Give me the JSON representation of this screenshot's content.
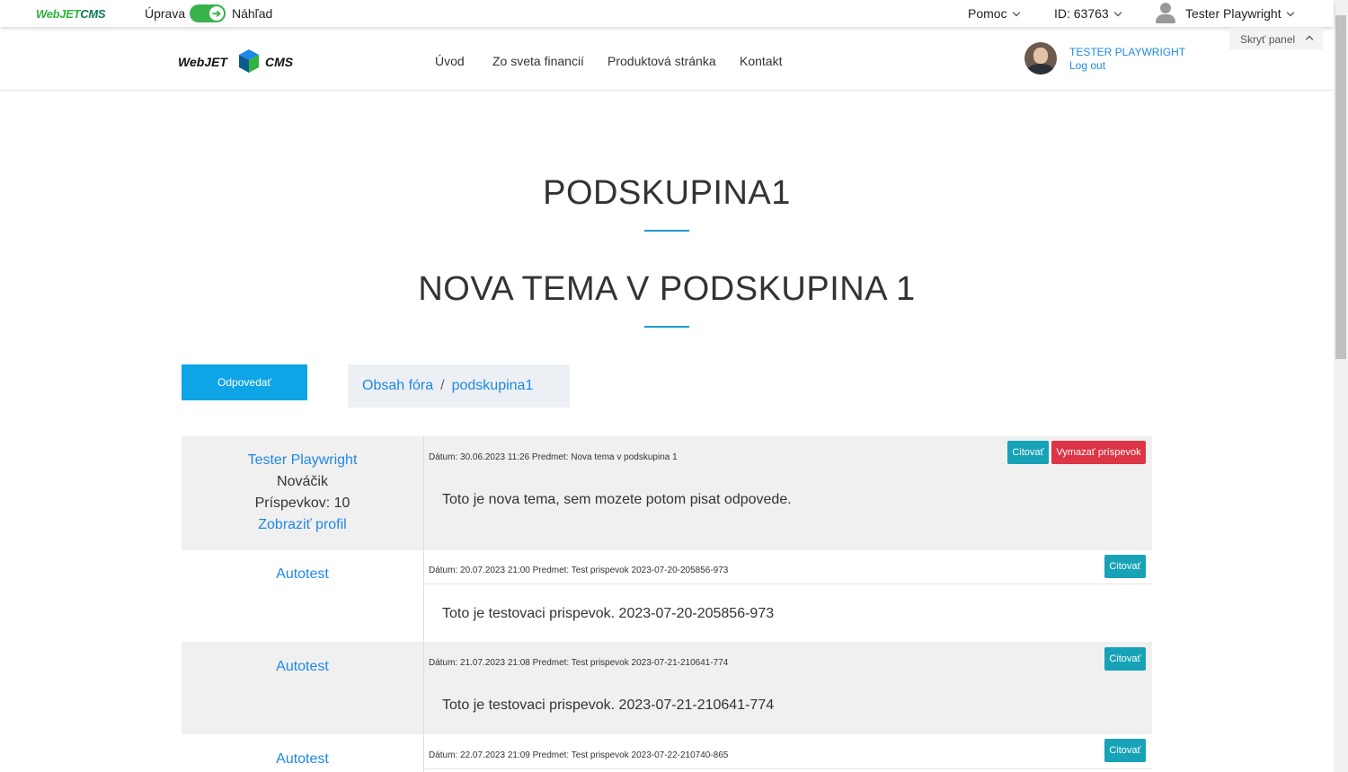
{
  "adminbar": {
    "logo_a": "WebJET",
    "logo_b": "CMS",
    "edit_label": "Úprava",
    "preview_label": "Náhľad",
    "help_label": "Pomoc",
    "doc_id": "ID: 63763",
    "user_name": "Tester Playwright",
    "hide_panel": "Skryť panel"
  },
  "site": {
    "logo_left": "WebJET",
    "logo_right": "CMS",
    "nav": [
      "Úvod",
      "Zo sveta financií",
      "Produktová stránka",
      "Kontakt"
    ],
    "user_name": "TESTER PLAYWRIGHT",
    "logout": "Log out"
  },
  "page": {
    "group_title": "PODSKUPINA1",
    "topic_title": "NOVA TEMA V PODSKUPINA 1",
    "reply_button": "Odpovedať",
    "breadcrumb": [
      "Obsah fóra",
      "podskupina1"
    ],
    "breadcrumb_sep": "/"
  },
  "posts": [
    {
      "author": "Tester Playwright",
      "rank": "Nováčik",
      "posts_count": "Príspevkov: 10",
      "profile_link": "Zobraziť profil",
      "meta": "Dátum: 30.06.2023 11:26 Predmet: Nova tema v podskupina 1",
      "text": "Toto je nova tema, sem mozete potom pisat odpovede.",
      "cite": "Citovať",
      "delete": "Vymazať príspevok"
    },
    {
      "author": "Autotest",
      "meta": "Dátum: 20.07.2023 21:00 Predmet: Test prispevok 2023-07-20-205856-973",
      "text": "Toto je testovaci prispevok. 2023-07-20-205856-973",
      "cite": "Citovať"
    },
    {
      "author": "Autotest",
      "meta": "Dátum: 21.07.2023 21:08 Predmet: Test prispevok 2023-07-21-210641-774",
      "text": "Toto je testovaci prispevok. 2023-07-21-210641-774",
      "cite": "Citovať"
    },
    {
      "author": "Autotest",
      "meta": "Dátum: 22.07.2023 21:09 Predmet: Test prispevok 2023-07-22-210740-865",
      "cite": "Citovať"
    }
  ],
  "colors": {
    "accent": "#1e88e5",
    "reply_button": "#0ea5e6",
    "cite_button": "#17a2b8",
    "delete_button": "#dc3545",
    "toggle": "#37b34a"
  }
}
